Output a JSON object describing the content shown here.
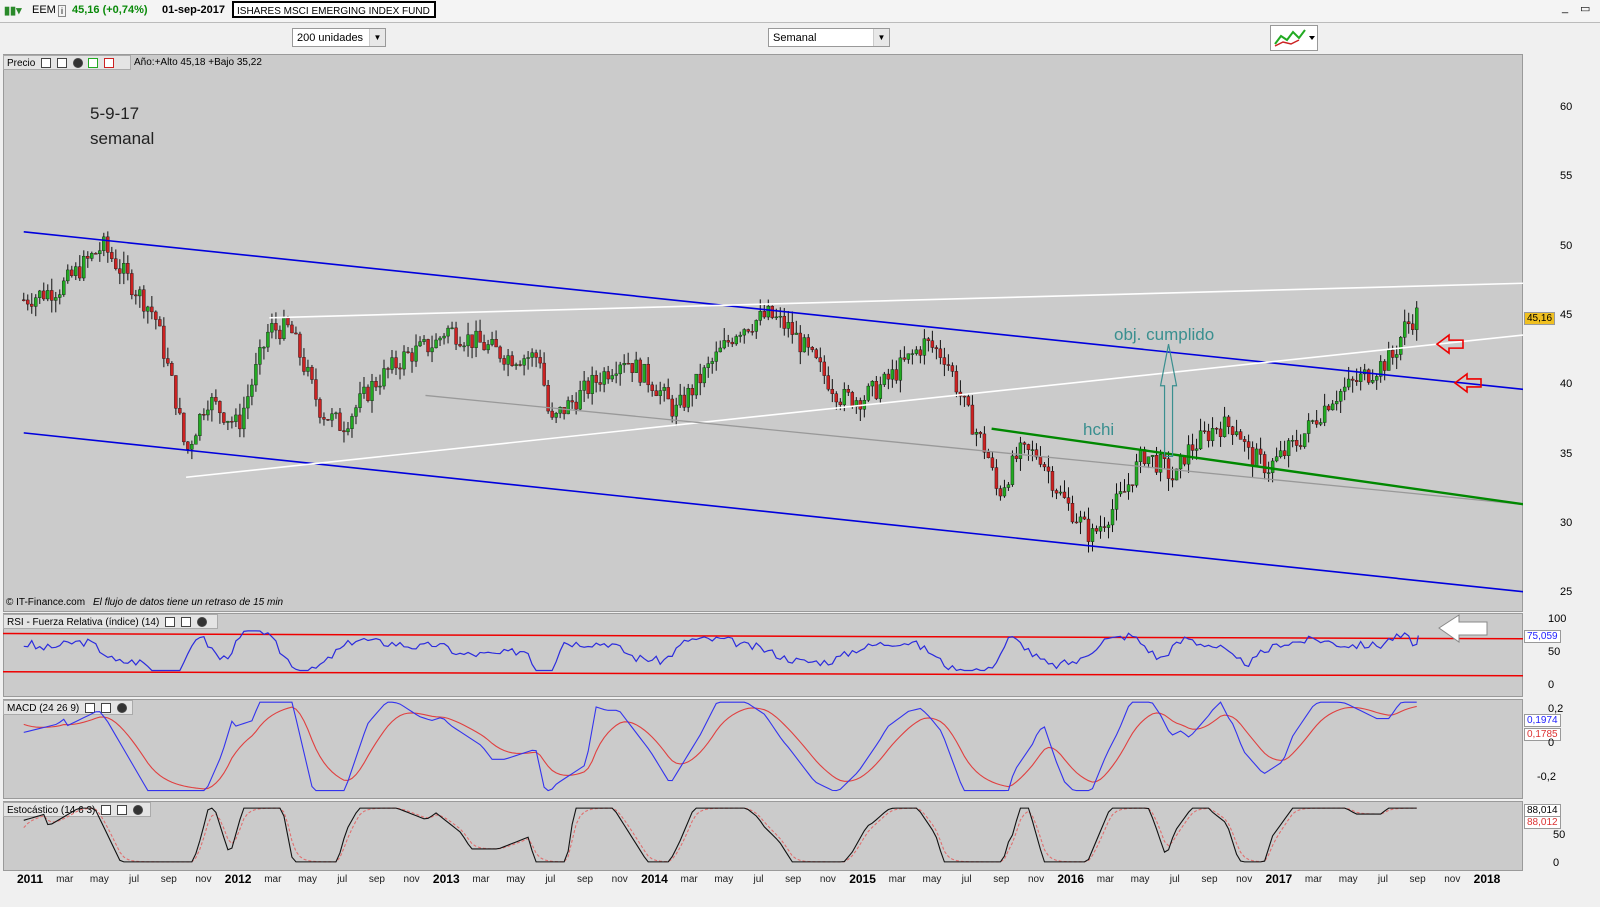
{
  "header": {
    "ticker": "EEM",
    "quote": "45,16 (+0,74%)",
    "date": "01-sep-2017",
    "fund_name": "ISHARES MSCI EMERGING INDEX FUND"
  },
  "toolbar": {
    "units_select": "200 unidades",
    "period_select": "Semanal"
  },
  "price_panel": {
    "label": "Precio",
    "year_info": "Año:+Alto 45,18 +Bajo 35,22",
    "last_price_tag": "45,16",
    "copyright": "© IT-Finance.com",
    "delay_note": "El flujo de datos tiene un retraso de 15 min",
    "annotation_date": "5-9-17",
    "annotation_period": "semanal",
    "annotation_target": "obj. cumplido",
    "annotation_pattern": "hchi",
    "y_ticks": [
      "60",
      "55",
      "50",
      "45",
      "40",
      "35",
      "30",
      "25"
    ]
  },
  "rsi_panel": {
    "label": "RSI - Fuerza Relativa (índice) (14)",
    "value_tag": "75,059",
    "y_ticks": [
      "100",
      "50",
      "0"
    ]
  },
  "macd_panel": {
    "label": "MACD (24 26 9)",
    "value_tag_1": "0,1974",
    "value_tag_2": "0,1785",
    "y_ticks": [
      "0,2",
      "0",
      "-0,2"
    ]
  },
  "stoch_panel": {
    "label": "Estocástico (14 6 3)",
    "value_tag_1": "88,014",
    "value_tag_2": "88,012",
    "y_ticks": [
      "50",
      "0"
    ]
  },
  "colors": {
    "panel_bg": "#cbcbcb",
    "up_candle": "#22aa22",
    "down_candle": "#cc2222",
    "channel": "#0000dd",
    "green_line": "#008800",
    "rsi": "#2b2bdd",
    "red_band": "#ee0000",
    "annotation_teal": "#3a8f8f"
  },
  "chart_data": {
    "type": "candlestick",
    "x_labels": [
      {
        "label": "2011",
        "year": true
      },
      {
        "label": "mar"
      },
      {
        "label": "may"
      },
      {
        "label": "jul"
      },
      {
        "label": "sep"
      },
      {
        "label": "nov"
      },
      {
        "label": "2012",
        "year": true
      },
      {
        "label": "mar"
      },
      {
        "label": "may"
      },
      {
        "label": "jul"
      },
      {
        "label": "sep"
      },
      {
        "label": "nov"
      },
      {
        "label": "2013",
        "year": true
      },
      {
        "label": "mar"
      },
      {
        "label": "may"
      },
      {
        "label": "jul"
      },
      {
        "label": "sep"
      },
      {
        "label": "nov"
      },
      {
        "label": "2014",
        "year": true
      },
      {
        "label": "mar"
      },
      {
        "label": "may"
      },
      {
        "label": "jul"
      },
      {
        "label": "sep"
      },
      {
        "label": "nov"
      },
      {
        "label": "2015",
        "year": true
      },
      {
        "label": "mar"
      },
      {
        "label": "may"
      },
      {
        "label": "jul"
      },
      {
        "label": "sep"
      },
      {
        "label": "nov"
      },
      {
        "label": "2016",
        "year": true
      },
      {
        "label": "mar"
      },
      {
        "label": "may"
      },
      {
        "label": "jul"
      },
      {
        "label": "sep"
      },
      {
        "label": "nov"
      },
      {
        "label": "2017",
        "year": true
      },
      {
        "label": "mar"
      },
      {
        "label": "may"
      },
      {
        "label": "jul"
      },
      {
        "label": "sep"
      },
      {
        "label": "nov"
      },
      {
        "label": "2018",
        "year": true
      }
    ],
    "ylim": [
      25,
      62
    ],
    "price_path": [
      [
        "2010.95",
        46
      ],
      [
        "2011.15",
        47
      ],
      [
        "2011.35",
        50
      ],
      [
        "2011.5",
        47
      ],
      [
        "2011.6",
        45
      ],
      [
        "2011.7",
        39
      ],
      [
        "2011.75",
        35
      ],
      [
        "2011.85",
        39
      ],
      [
        "2012.0",
        37
      ],
      [
        "2012.15",
        44
      ],
      [
        "2012.25",
        44
      ],
      [
        "2012.4",
        38
      ],
      [
        "2012.5",
        37
      ],
      [
        "2012.65",
        40
      ],
      [
        "2012.8",
        42
      ],
      [
        "2012.95",
        43
      ],
      [
        "2013.0",
        44
      ],
      [
        "2013.15",
        43
      ],
      [
        "2013.3",
        42
      ],
      [
        "2013.45",
        42
      ],
      [
        "2013.5",
        37
      ],
      [
        "2013.55",
        38
      ],
      [
        "2013.7",
        40
      ],
      [
        "2013.85",
        42
      ],
      [
        "2014.0",
        40
      ],
      [
        "2014.1",
        38
      ],
      [
        "2014.25",
        41
      ],
      [
        "2014.4",
        44
      ],
      [
        "2014.55",
        45
      ],
      [
        "2014.65",
        44
      ],
      [
        "2014.75",
        42
      ],
      [
        "2014.9",
        39
      ],
      [
        "2015.0",
        39
      ],
      [
        "2015.1",
        40
      ],
      [
        "2015.3",
        43
      ],
      [
        "2015.4",
        42
      ],
      [
        "2015.5",
        38
      ],
      [
        "2015.6",
        35
      ],
      [
        "2015.65",
        32
      ],
      [
        "2015.75",
        35
      ],
      [
        "2015.85",
        35
      ],
      [
        "2015.95",
        32
      ],
      [
        "2016.05",
        30
      ],
      [
        "2016.1",
        29
      ],
      [
        "2016.25",
        32
      ],
      [
        "2016.35",
        35
      ],
      [
        "2016.45",
        34
      ],
      [
        "2016.5",
        33
      ],
      [
        "2016.55",
        35
      ],
      [
        "2016.7",
        37
      ],
      [
        "2016.8",
        37
      ],
      [
        "2016.85",
        35
      ],
      [
        "2016.95",
        34
      ],
      [
        "2017.1",
        36
      ],
      [
        "2017.25",
        39
      ],
      [
        "2017.35",
        40
      ],
      [
        "2017.45",
        41
      ],
      [
        "2017.55",
        42
      ],
      [
        "2017.6",
        44
      ],
      [
        "2017.67",
        45.16
      ]
    ],
    "last_close": 45.16,
    "year_high": 45.18,
    "year_low": 35.22,
    "rsi_last": 75.059,
    "macd_last": 0.1974,
    "macd_signal_last": 0.1785,
    "stoch_k_last": 88.014,
    "stoch_d_last": 88.012
  }
}
